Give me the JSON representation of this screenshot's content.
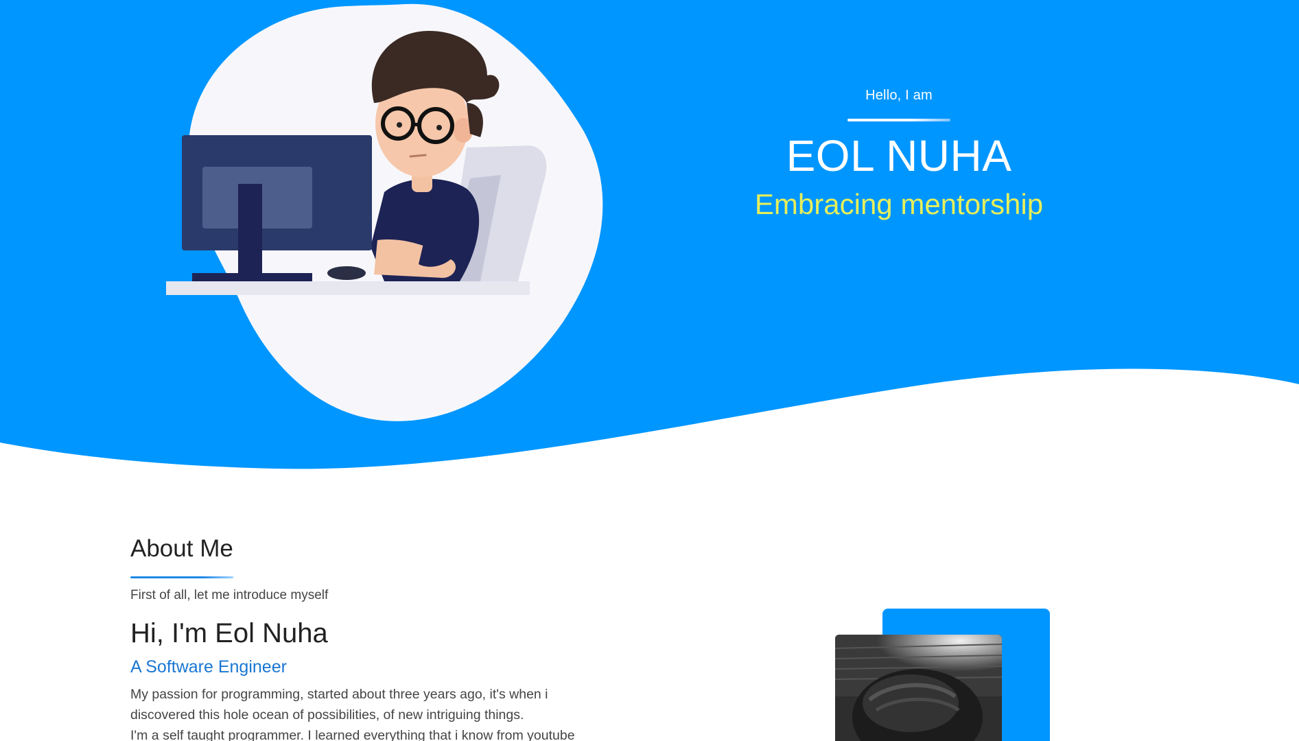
{
  "colors": {
    "hero_blue": "#0096ff",
    "tagline_yellow": "#e6ef5a",
    "role_blue": "#1976d2",
    "photo_frame_blue": "#0096ff"
  },
  "hero": {
    "greeting": "Hello, I am",
    "name": "EOL NUHA",
    "tagline": "Embracing mentorship",
    "illustration": "developer-at-computer-illustration"
  },
  "about": {
    "title": "About Me",
    "intro": "First of all, let me introduce myself",
    "hi": "Hi, I'm Eol Nuha",
    "role": "A Software Engineer",
    "desc_line1": "My passion for programming, started about three years ago, it's when i",
    "desc_line2": "discovered this hole ocean of possibilities, of new intriguing things.",
    "desc_line3": "I'm a self taught programmer. I learned everything that i know from youtube"
  },
  "photo": {
    "icon": "profile-photo"
  }
}
